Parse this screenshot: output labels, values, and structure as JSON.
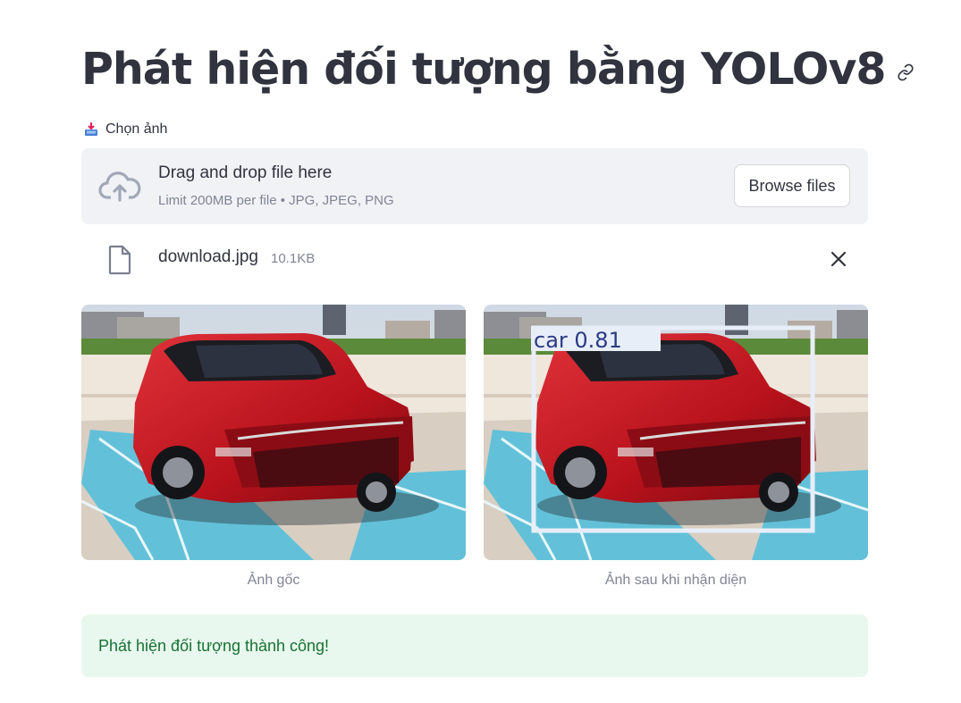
{
  "page": {
    "title": "Phát hiện đối tượng bằng YOLOv8"
  },
  "uploader": {
    "label": "Chọn ảnh",
    "drop_title": "Drag and drop file here",
    "drop_limit": "Limit 200MB per file • JPG, JPEG, PNG",
    "browse_label": "Browse files"
  },
  "file": {
    "name": "download.jpg",
    "size": "10.1KB"
  },
  "images": {
    "original_caption": "Ảnh gốc",
    "detected_caption": "Ảnh sau khi nhận diện",
    "detection_label": "car  0.81"
  },
  "alert": {
    "message": "Phát hiện đối tượng thành công!"
  },
  "colors": {
    "text": "#31333f",
    "muted": "#808495",
    "surface": "#f0f2f6",
    "success_bg": "#e8f8ee",
    "success_text": "#177233",
    "box": "#e8eef8"
  }
}
